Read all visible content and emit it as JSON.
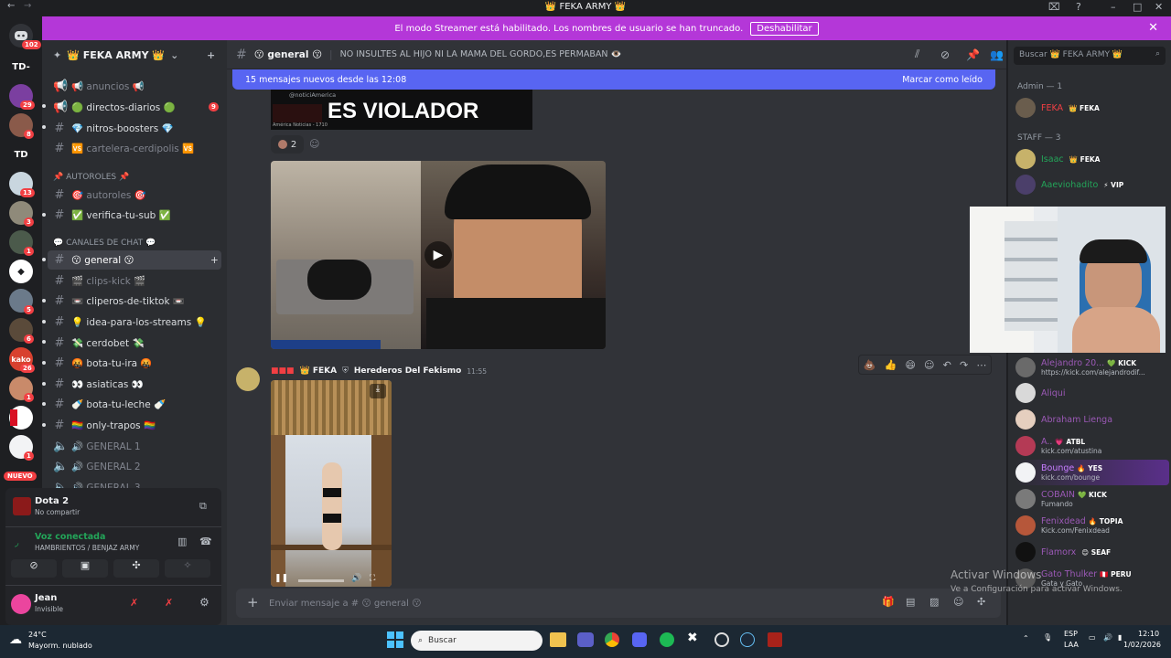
{
  "window": {
    "title": "👑 FEKA ARMY 👑"
  },
  "banner": {
    "message": "El modo Streamer está habilitado. Los nombres de usuario se han truncado.",
    "button": "Deshabilitar"
  },
  "rail": {
    "mentions": "102",
    "items": [
      {
        "label": "TD-"
      },
      {
        "label": "",
        "badge": "29"
      },
      {
        "label": "",
        "badge": "8"
      },
      {
        "label": "TD"
      },
      {
        "label": "",
        "badge": "13"
      },
      {
        "label": "",
        "badge": "3"
      },
      {
        "label": "",
        "badge": "1"
      },
      {
        "label": ""
      },
      {
        "label": "",
        "badge": "5"
      },
      {
        "label": "",
        "badge": "6"
      },
      {
        "label": "kako",
        "badge": "26"
      },
      {
        "label": "",
        "badge": "1"
      },
      {
        "label": ""
      },
      {
        "label": "",
        "badge": "1"
      }
    ],
    "new_label": "NUEVO"
  },
  "sidebar": {
    "guild_name": "👑 FEKA ARMY 👑",
    "channels_top": [
      {
        "name": "📢 anuncios 📢",
        "type": "announce",
        "muted": true
      },
      {
        "name": "🟢 directos-diarios 🟢",
        "type": "announce",
        "badge": "9"
      },
      {
        "name": "💎 nitros-boosters 💎",
        "type": "text"
      },
      {
        "name": "🆚 cartelera-cerdipolis 🆚",
        "type": "text",
        "muted": true
      }
    ],
    "cat_autoroles": "📌 AUTOROLES 📌",
    "channels_autoroles": [
      {
        "name": "🎯 autoroles 🎯",
        "type": "text",
        "muted": true
      },
      {
        "name": "✅ verifica-tu-sub ✅",
        "type": "text"
      }
    ],
    "cat_chat": "💬 CANALES DE CHAT 💬",
    "channels_chat": [
      {
        "name": "😗 general 😗",
        "type": "text",
        "active": true
      },
      {
        "name": "🎬 clips-kick 🎬",
        "type": "text",
        "muted": true
      },
      {
        "name": "📼 cliperos-de-tiktok 📼",
        "type": "text"
      },
      {
        "name": "💡 idea-para-los-streams 💡",
        "type": "text"
      },
      {
        "name": "💸 cerdobet 💸",
        "type": "text"
      },
      {
        "name": "🤬 bota-tu-ira 🤬",
        "type": "text"
      },
      {
        "name": "👀 asiaticas 👀",
        "type": "text"
      },
      {
        "name": "🍼 bota-tu-leche 🍼",
        "type": "text"
      },
      {
        "name": "🏳️‍🌈 only-trapos 🏳️‍🌈",
        "type": "text"
      },
      {
        "name": "🔊 GENERAL 1",
        "type": "voice",
        "muted": true
      },
      {
        "name": "🔊 GENERAL 2",
        "type": "voice",
        "muted": true
      },
      {
        "name": "🔊 GENERAL 3",
        "type": "voice",
        "muted": true
      }
    ],
    "activity": {
      "game": "Dota 2",
      "status": "No compartir"
    },
    "voice": {
      "title": "Voz conectada",
      "channel": "HAMBRIENTOS / BENJAZ ARMY"
    },
    "user": {
      "name": "Jean",
      "status": "Invisible"
    }
  },
  "chat": {
    "channel_name": "😗 general 😗",
    "topic": "NO INSULTES AL HIJO NI LA MAMA DEL GORDO,ES PERMABAN 👁️",
    "new_messages": "15 mensajes nuevos desde las 12:08",
    "mark_read": "Marcar como leído",
    "embed_headline": "ES VIOLADOR",
    "embed_source": "América Noticias - 1710",
    "embed_handle": "@noticiAmerica",
    "reaction_count": "2",
    "message": {
      "tag1": "👑 FEKA",
      "tag2": "Herederos Del Fekismo",
      "time": "11:55"
    },
    "composer_placeholder": "Enviar mensaje a # 😗 general 😗"
  },
  "members": {
    "search_placeholder": "Buscar 👑 FEKA ARMY 👑",
    "group_admin": "Admin — 1",
    "group_staff": "STAFF — 3",
    "list": [
      {
        "name": "FEKA",
        "tag": "👑 FEKA",
        "color": "#f23f43",
        "sub": ""
      },
      {
        "name": "Isaac",
        "tag": "👑 FEKA",
        "color": "#23a559",
        "sub": ""
      },
      {
        "name": "Aaeviohadito",
        "tag": "⚡ VIP",
        "color": "#23a559",
        "sub": ""
      },
      {
        "name": "Alejandro 20...",
        "tag": "💚 KICK",
        "color": "#9b59b6",
        "sub": "https://kick.com/alejandrodif..."
      },
      {
        "name": "Aliqui",
        "tag": "",
        "color": "#9b59b6",
        "sub": ""
      },
      {
        "name": "Abraham Lienga",
        "tag": "",
        "color": "#9b59b6",
        "sub": ""
      },
      {
        "name": "A..",
        "tag": "💗 ATBL",
        "color": "#9b59b6",
        "sub": "kick.com/atustina"
      },
      {
        "name": "Bounge",
        "tag": "🔥 YES",
        "color": "#9b59b6",
        "sub": "kick.com/bounge"
      },
      {
        "name": "COBAIN",
        "tag": "💚 KICK",
        "color": "#9b59b6",
        "sub": "Fumando"
      },
      {
        "name": "Fenixdead",
        "tag": "🔥 TOPIA",
        "color": "#9b59b6",
        "sub": "Kick.com/Fenixdead"
      },
      {
        "name": "Flamorx",
        "tag": "😊 SEAF",
        "color": "#9b59b6",
        "sub": ""
      },
      {
        "name": "Gato Thulker",
        "tag": "🇵🇪 PERU",
        "color": "#9b59b6",
        "sub": "Gata y Gato"
      }
    ]
  },
  "watermark": {
    "title": "Activar Windows",
    "subtitle": "Ve a Configuración para activar Windows."
  },
  "taskbar": {
    "temp": "24°C",
    "weather": "Mayorm. nublado",
    "search": "Buscar",
    "lang": "ESP",
    "lang2": "LAA",
    "time": "12:10",
    "date": "1/02/2026"
  }
}
